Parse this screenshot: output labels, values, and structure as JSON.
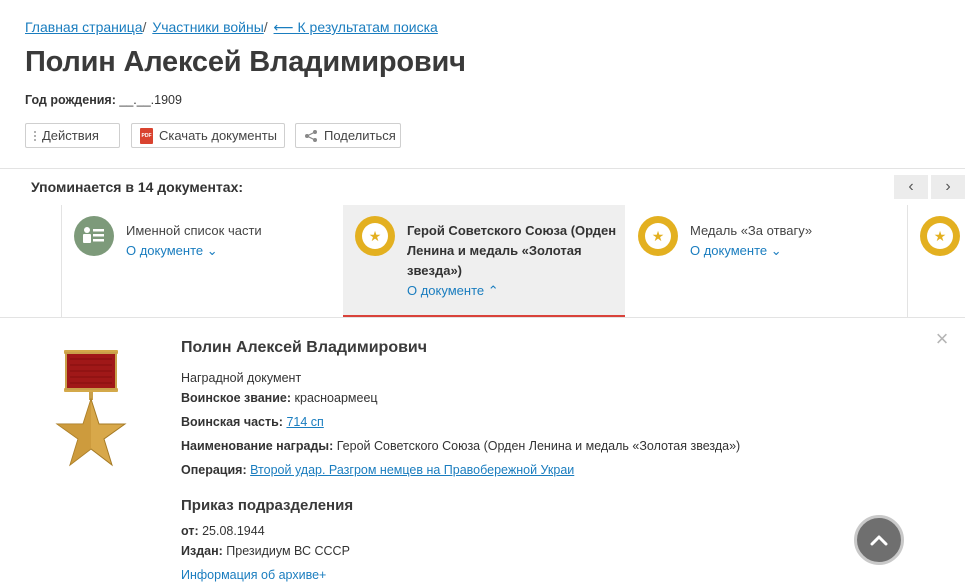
{
  "breadcrumb": {
    "home": "Главная страница",
    "section": "Участники войны",
    "back": "⟵ К результатам поиска",
    "sep": "/"
  },
  "person": {
    "name": "Полин Алексей Владимирович",
    "birth_label": "Год рождения:",
    "birth_value": "__.__.1909"
  },
  "actions": {
    "actions_label": "Действия",
    "download_label": "Скачать документы",
    "share_label": "Поделиться"
  },
  "mentions": {
    "label": "Упоминается в 14 документах:",
    "prev": "‹",
    "next": "›",
    "cards": [
      {
        "title": "Именной список части",
        "link": "О документе ⌄",
        "icon": "person-list-icon"
      },
      {
        "title": "Герой Советского Союза (Орден Ленина и медаль «Золотая звезда»)",
        "link": "О документе ⌃",
        "icon": "star-medal-icon",
        "active": true
      },
      {
        "title": "Медаль «За отвагу»",
        "link": "О документе ⌄",
        "icon": "star-medal-icon"
      }
    ]
  },
  "detail": {
    "name": "Полин Алексей Владимирович",
    "doc_type": "Наградной документ",
    "rank_label": "Воинское звание:",
    "rank_value": "красноармеец",
    "unit_label": "Воинская часть:",
    "unit_value": "714 сп",
    "award_label": "Наименование награды:",
    "award_value": "Герой Советского Союза (Орден Ленина и медаль «Золотая звезда»)",
    "operation_label": "Операция:",
    "operation_value": "Второй удар. Разгром немцев на Правобережной Украи",
    "section_title": "Приказ подразделения",
    "date_label": "от:",
    "date_value": "25.08.1944",
    "issuer_label": "Издан:",
    "issuer_value": "Президиум ВС СССР",
    "archive_link": "Информация об архиве+"
  },
  "colors": {
    "link": "#1a7dbf",
    "gold": "#e3b020",
    "green_badge": "#7d9a7a",
    "active_underline": "#d9423a"
  }
}
